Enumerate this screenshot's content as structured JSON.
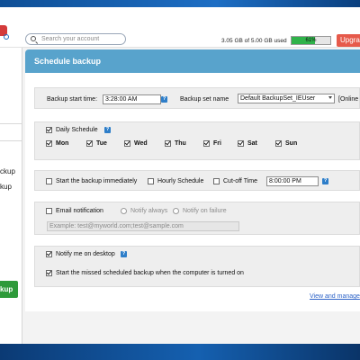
{
  "header": {
    "search_placeholder": "Search your account",
    "quota_text": "3.05 GB of 5.00 GB used",
    "quota_percent_label": "61%",
    "quota_fraction": 0.61,
    "upgrade_label": "Upgra"
  },
  "left_panel": {
    "text1": "ckup",
    "text2": "kup",
    "button_label": "kup"
  },
  "schedule": {
    "title": "Schedule backup",
    "start_time_label": "Backup start time:",
    "start_time_value": "3:28:00 AM",
    "backup_set_label": "Backup set name",
    "backup_set_value": "Default BackupSet_IEUser",
    "online_label": "[Online",
    "daily_label": "Daily Schedule",
    "days": [
      "Mon",
      "Tue",
      "Wed",
      "Thu",
      "Fri",
      "Sat",
      "Sun"
    ],
    "start_immediately_label": "Start the backup immediately",
    "hourly_label": "Hourly Schedule",
    "cutoff_label": "Cut-off Time",
    "cutoff_value": "8:00:00 PM",
    "email_label": "Email notification",
    "notify_always_label": "Notify always",
    "notify_failure_label": "Notify on failure",
    "email_placeholder": "Example: test@myworld.com;test@sample.com",
    "notify_desktop_label": "Notify me on desktop",
    "missed_label": "Start the missed scheduled backup when the computer is turned on",
    "view_link": "View and manage"
  },
  "colors": {
    "accent_header": "#58a3cc",
    "upgrade": "#e65a4b",
    "progress": "#2fb34a",
    "link": "#2d63c8",
    "help_icon": "#2e7ec9"
  }
}
